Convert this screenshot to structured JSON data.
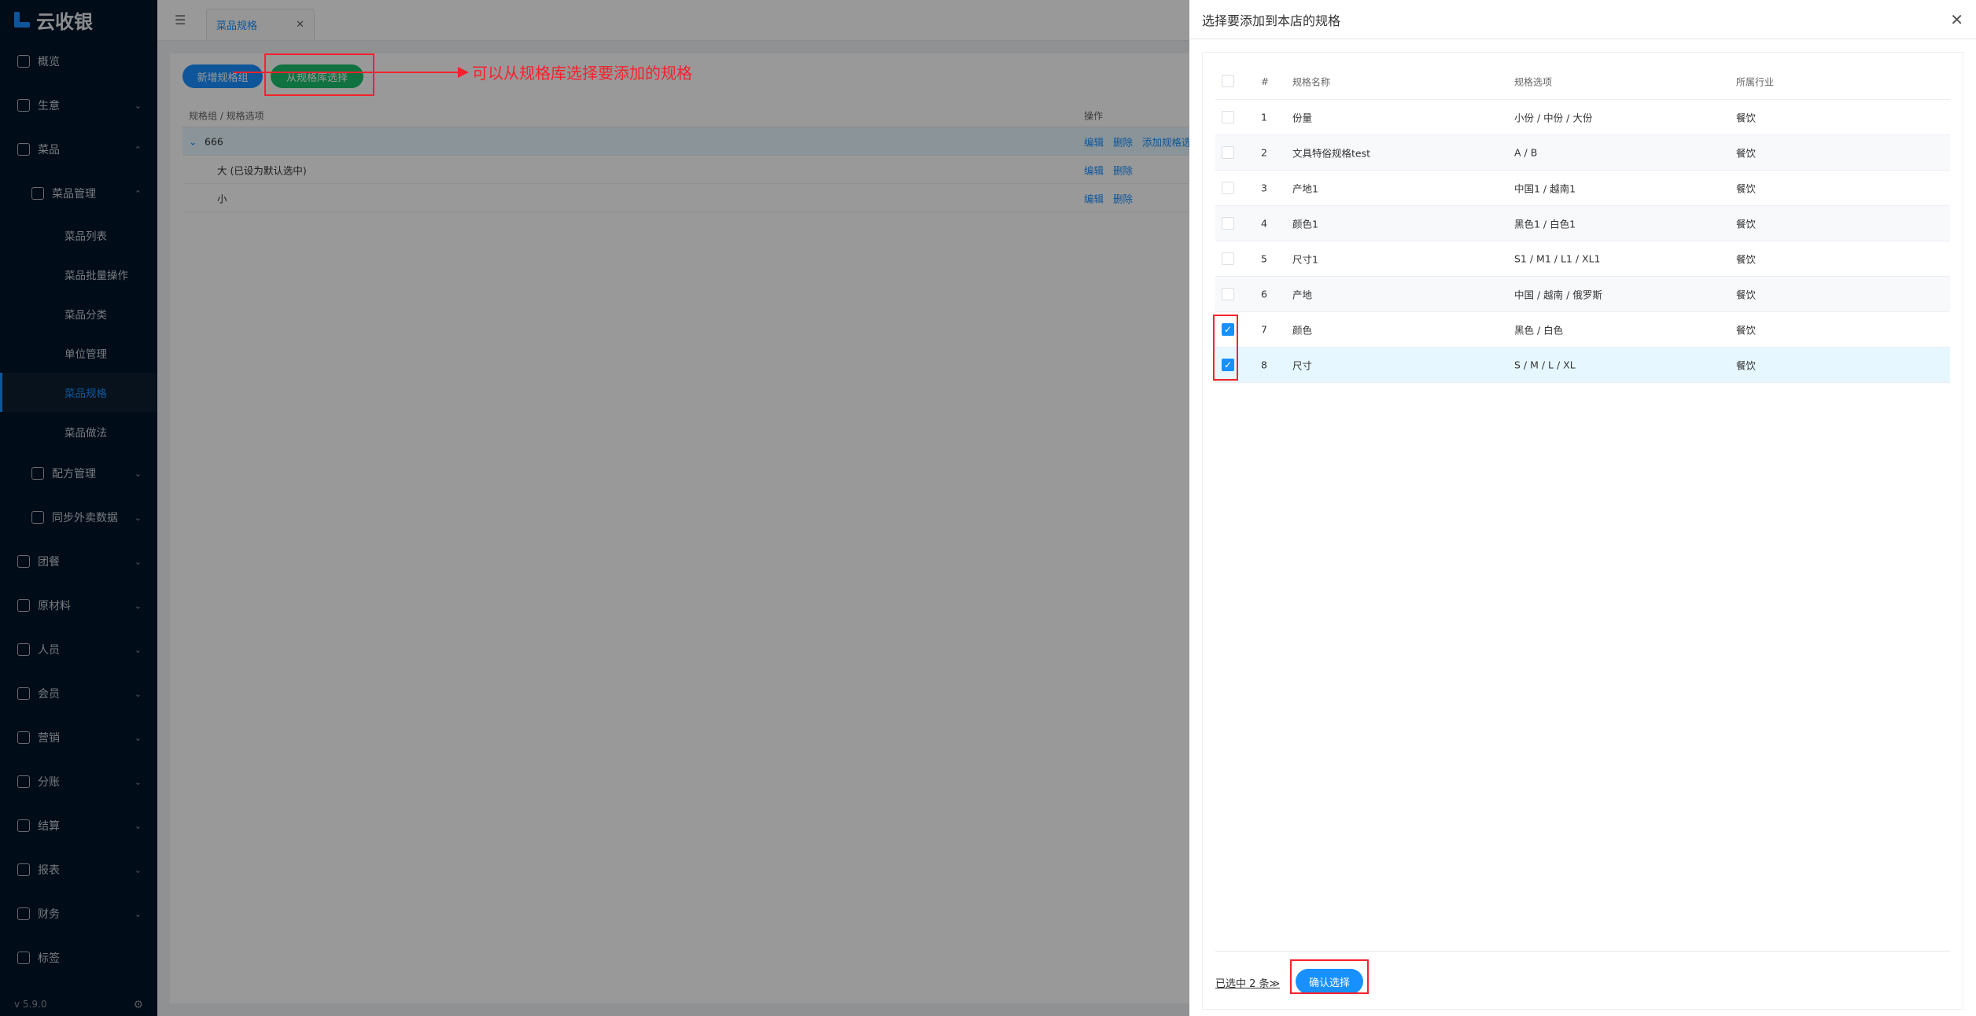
{
  "app": {
    "logo_text": "云收银",
    "version": "v 5.9.0"
  },
  "sidebar": {
    "items": [
      {
        "label": "概览",
        "level": 0
      },
      {
        "label": "生意",
        "level": 0,
        "chevron": "down"
      },
      {
        "label": "菜品",
        "level": 0,
        "chevron": "up"
      },
      {
        "label": "菜品管理",
        "level": 1,
        "chevron": "up"
      },
      {
        "label": "菜品列表",
        "level": 2
      },
      {
        "label": "菜品批量操作",
        "level": 2
      },
      {
        "label": "菜品分类",
        "level": 2
      },
      {
        "label": "单位管理",
        "level": 2
      },
      {
        "label": "菜品规格",
        "level": 2,
        "active": true
      },
      {
        "label": "菜品做法",
        "level": 2
      },
      {
        "label": "配方管理",
        "level": 1,
        "chevron": "down"
      },
      {
        "label": "同步外卖数据",
        "level": 1,
        "chevron": "down"
      },
      {
        "label": "团餐",
        "level": 0,
        "chevron": "down"
      },
      {
        "label": "原材料",
        "level": 0,
        "chevron": "down"
      },
      {
        "label": "人员",
        "level": 0,
        "chevron": "down"
      },
      {
        "label": "会员",
        "level": 0,
        "chevron": "down"
      },
      {
        "label": "营销",
        "level": 0,
        "chevron": "down"
      },
      {
        "label": "分账",
        "level": 0,
        "chevron": "down"
      },
      {
        "label": "结算",
        "level": 0,
        "chevron": "down"
      },
      {
        "label": "报表",
        "level": 0,
        "chevron": "down"
      },
      {
        "label": "财务",
        "level": 0,
        "chevron": "down"
      },
      {
        "label": "标签",
        "level": 0
      }
    ]
  },
  "tabs": [
    {
      "label": "菜品规格"
    }
  ],
  "toolbar": {
    "add_group_label": "新增规格组",
    "from_library_label": "从规格库选择"
  },
  "annotation": {
    "text": "可以从规格库选择要添加的规格"
  },
  "spec_table": {
    "col_group": "规格组 / 规格选项",
    "col_ops": "操作",
    "rows": [
      {
        "name": "666",
        "ops": [
          "编辑",
          "删除",
          "添加规格选项"
        ],
        "expand": "⌄"
      },
      {
        "name": "大 (已设为默认选中)",
        "ops": [
          "编辑",
          "删除"
        ]
      },
      {
        "name": "小",
        "ops": [
          "编辑",
          "删除"
        ]
      }
    ]
  },
  "drawer": {
    "title": "选择要添加到本店的规格",
    "columns": {
      "idx": "#",
      "name": "规格名称",
      "options": "规格选项",
      "industry": "所属行业"
    },
    "rows": [
      {
        "idx": "1",
        "name": "份量",
        "options": "小份 / 中份 / 大份",
        "industry": "餐饮",
        "checked": false
      },
      {
        "idx": "2",
        "name": "文具特俗规格test",
        "options": "A / B",
        "industry": "餐饮",
        "checked": false
      },
      {
        "idx": "3",
        "name": "产地1",
        "options": "中国1 / 越南1",
        "industry": "餐饮",
        "checked": false
      },
      {
        "idx": "4",
        "name": "颜色1",
        "options": "黑色1 / 白色1",
        "industry": "餐饮",
        "checked": false
      },
      {
        "idx": "5",
        "name": "尺寸1",
        "options": "S1 / M1 / L1 / XL1",
        "industry": "餐饮",
        "checked": false
      },
      {
        "idx": "6",
        "name": "产地",
        "options": "中国 / 越南 / 俄罗斯",
        "industry": "餐饮",
        "checked": false
      },
      {
        "idx": "7",
        "name": "颜色",
        "options": "黑色 / 白色",
        "industry": "餐饮",
        "checked": true
      },
      {
        "idx": "8",
        "name": "尺寸",
        "options": "S / M / L / XL",
        "industry": "餐饮",
        "checked": true
      }
    ],
    "selected_text": "已选中 2 条≫",
    "confirm_label": "确认选择"
  },
  "colors": {
    "primary": "#1890ff",
    "green": "#19be6b",
    "annotation": "#f5222d",
    "sidebar_bg": "#001529"
  }
}
